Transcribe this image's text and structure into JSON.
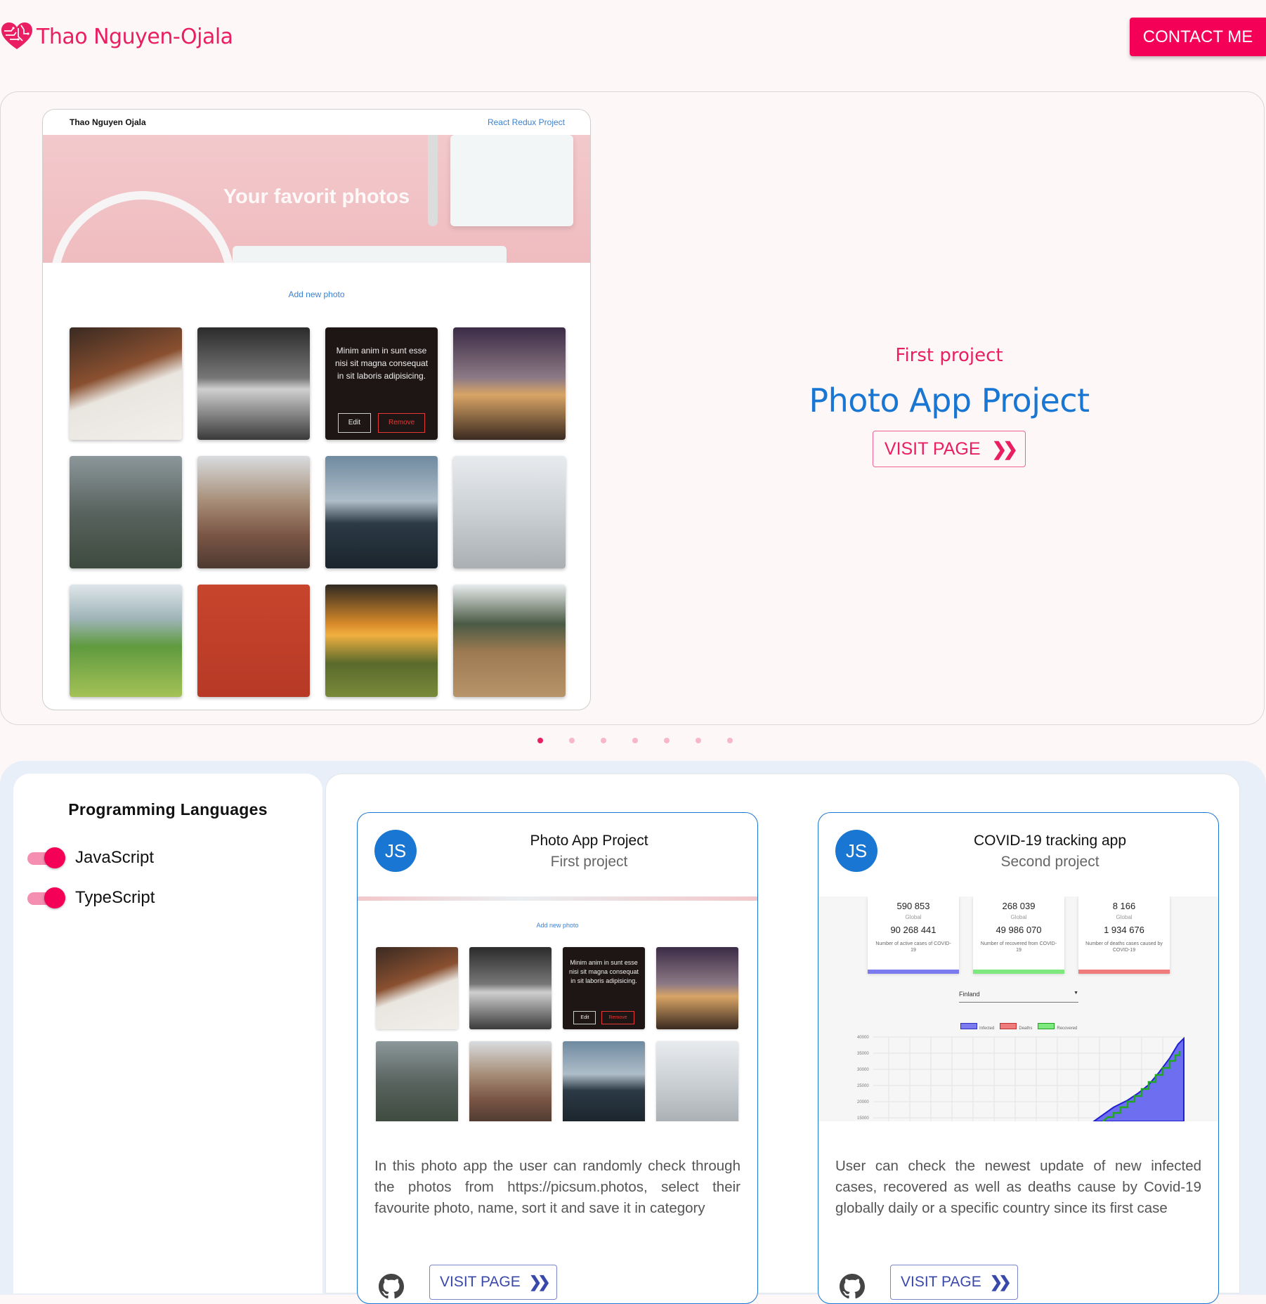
{
  "header": {
    "name": "Thao Nguyen-Ojala",
    "contact_label": "CONTACT ME"
  },
  "hero": {
    "screenshot": {
      "brand": "Thao Nguyen Ojala",
      "nav_link": "React Redux Project",
      "banner_title": "Your favorit photos",
      "add_link": "Add new photo",
      "overlay_text": "Minim anim in sunt esse nisi sit magna consequat in sit laboris adipisicing.",
      "edit_label": "Edit",
      "remove_label": "Remove"
    },
    "subtitle": "First project",
    "title": "Photo App Project",
    "visit_label": "VISIT PAGE",
    "slides": 7,
    "active_slide": 1
  },
  "languages": {
    "title": "Programming Languages",
    "items": [
      {
        "label": "JavaScript",
        "enabled": true
      },
      {
        "label": "TypeScript",
        "enabled": true
      }
    ]
  },
  "cards": [
    {
      "avatar": "JS",
      "title": "Photo App Project",
      "subtitle": "First project",
      "add_link": "Add new photo",
      "overlay_text": "Minim anim in sunt esse nisi sit magna consequat in sit laboris adipisicing.",
      "edit_label": "Edit",
      "remove_label": "Remove",
      "description": "In this photo app the user can randomly check through the photos from https://picsum.photos, select their favourite photo, name, sort it and save it in category",
      "visit_label": "VISIT PAGE"
    },
    {
      "avatar": "JS",
      "title": "COVID-19 tracking app",
      "subtitle": "Second project",
      "stats": [
        {
          "new": "590 853",
          "scope": "Global",
          "total": "90 268 441",
          "note": "Number of active cases of COVID-19",
          "color": "#7b7bef"
        },
        {
          "new": "268 039",
          "scope": "Global",
          "total": "49 986 070",
          "note": "Number of recovered from COVID-19",
          "color": "#7de87d"
        },
        {
          "new": "8 166",
          "scope": "Global",
          "total": "1 934 676",
          "note": "Number of deaths cases caused by COVID-19",
          "color": "#f07b7b"
        }
      ],
      "country": "Finland",
      "legend": [
        "Infected",
        "Deaths",
        "Recovered"
      ],
      "y_ticks": [
        "40000",
        "35000",
        "30000",
        "25000",
        "20000",
        "15000"
      ],
      "description": "User can check the newest update of new infected cases, recovered as well as deaths cause by Covid-19 globally daily or a specific country since its first case",
      "visit_label": "VISIT PAGE"
    }
  ],
  "colors": {
    "accent": "#e91e63",
    "primary": "#1976d2",
    "contact_bg": "#f50057"
  }
}
